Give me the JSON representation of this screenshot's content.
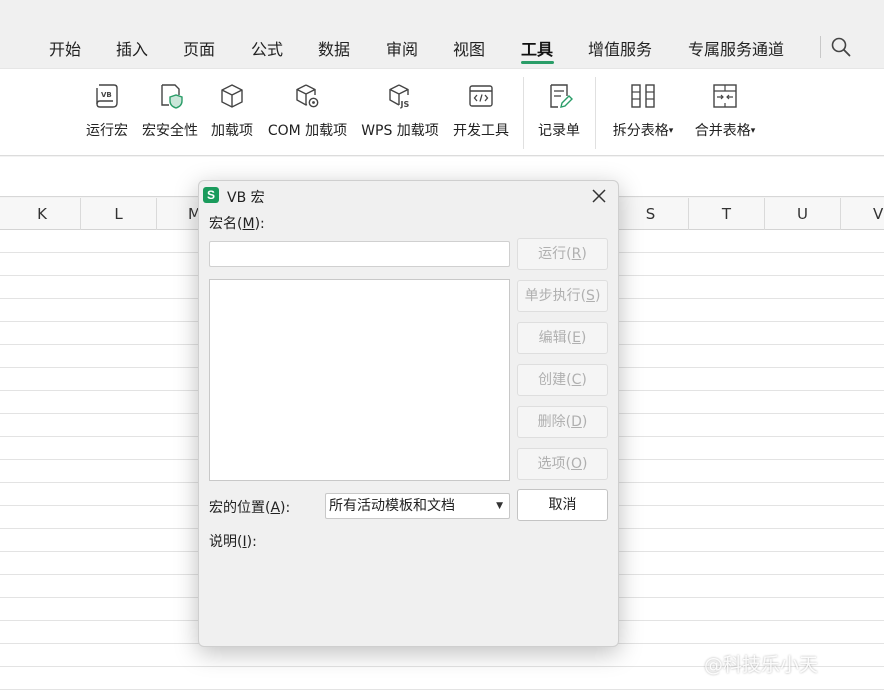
{
  "menu": {
    "tabs": [
      "开始",
      "插入",
      "页面",
      "公式",
      "数据",
      "审阅",
      "视图",
      "工具",
      "增值服务",
      "专属服务通道"
    ],
    "active_tab": "工具"
  },
  "ribbon": {
    "run_macro": "运行宏",
    "macro_security": "宏安全性",
    "addins": "加载项",
    "com_addins": "COM 加载项",
    "wps_addins": "WPS 加载项",
    "dev_tools": "开发工具",
    "record_sheet": "记录单",
    "split_table": "拆分表格",
    "merge_table": "合并表格"
  },
  "sheet": {
    "columns": [
      "K",
      "L",
      "M",
      "",
      "",
      "",
      "",
      "",
      "S",
      "T",
      "U",
      "V"
    ]
  },
  "dialog": {
    "title": "VB 宏",
    "macro_name_label": "宏名",
    "macro_name_key": "M",
    "macro_name_value": "",
    "buttons": {
      "run": {
        "text": "运行",
        "key": "R"
      },
      "step": {
        "text": "单步执行",
        "key": "S"
      },
      "edit": {
        "text": "编辑",
        "key": "E"
      },
      "create": {
        "text": "创建",
        "key": "C"
      },
      "delete": {
        "text": "删除",
        "key": "D"
      },
      "options": {
        "text": "选项",
        "key": "O"
      },
      "cancel": "取消"
    },
    "location_label": "宏的位置",
    "location_key": "A",
    "location_value": "所有活动模板和文档",
    "description_label": "说明",
    "description_key": "I"
  },
  "watermark": "@科技乐小天",
  "colors": {
    "accent": "#2a9d68",
    "logo": "#1a9b5c",
    "disabled_text": "#b0b0b0"
  }
}
